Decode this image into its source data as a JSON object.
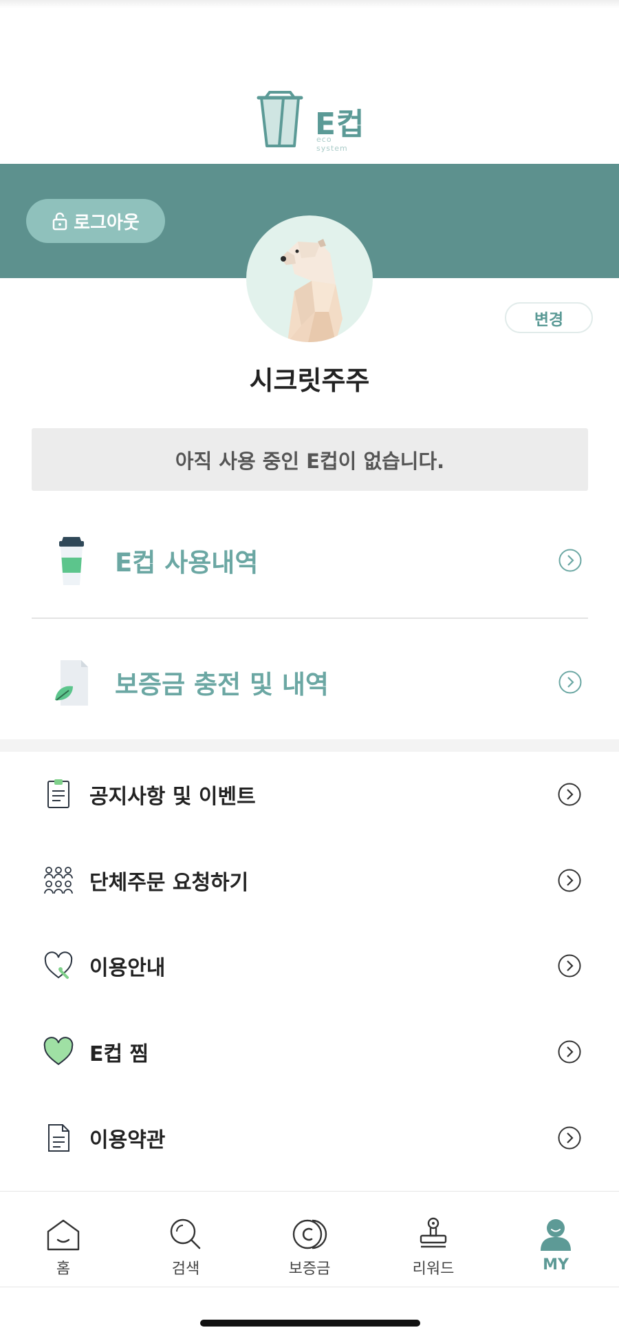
{
  "header": {
    "logo_text": "E컵",
    "logo_subtext": "eco system"
  },
  "profile": {
    "logout_label": "로그아웃",
    "change_label": "변경",
    "nickname": "시크릿주주",
    "avatar_icon": "polar-bear-avatar"
  },
  "cup_status": "아직 사용 중인 E컵이 없습니다.",
  "features": [
    {
      "label": "E컵 사용내역",
      "icon": "cup-icon"
    },
    {
      "label": "보증금 충전 및 내역",
      "icon": "deposit-document-icon"
    }
  ],
  "menu": [
    {
      "label": "공지사항 및 이벤트",
      "icon": "clipboard-icon"
    },
    {
      "label": "단체주문 요청하기",
      "icon": "group-icon"
    },
    {
      "label": "이용안내",
      "icon": "heart-guide-icon"
    },
    {
      "label": "E컵 찜",
      "icon": "heart-icon"
    },
    {
      "label": "이용약관",
      "icon": "document-icon"
    }
  ],
  "tabbar": [
    {
      "label": "홈",
      "icon": "home-icon"
    },
    {
      "label": "검색",
      "icon": "search-icon"
    },
    {
      "label": "보증금",
      "icon": "deposit-icon"
    },
    {
      "label": "리워드",
      "icon": "stamp-icon"
    },
    {
      "label": "MY",
      "icon": "profile-icon",
      "active": true
    }
  ],
  "colors": {
    "brand": "#5d918e",
    "accent": "#6ba7a3",
    "button_light": "#8fc1bc",
    "status_bg": "#ececec"
  }
}
